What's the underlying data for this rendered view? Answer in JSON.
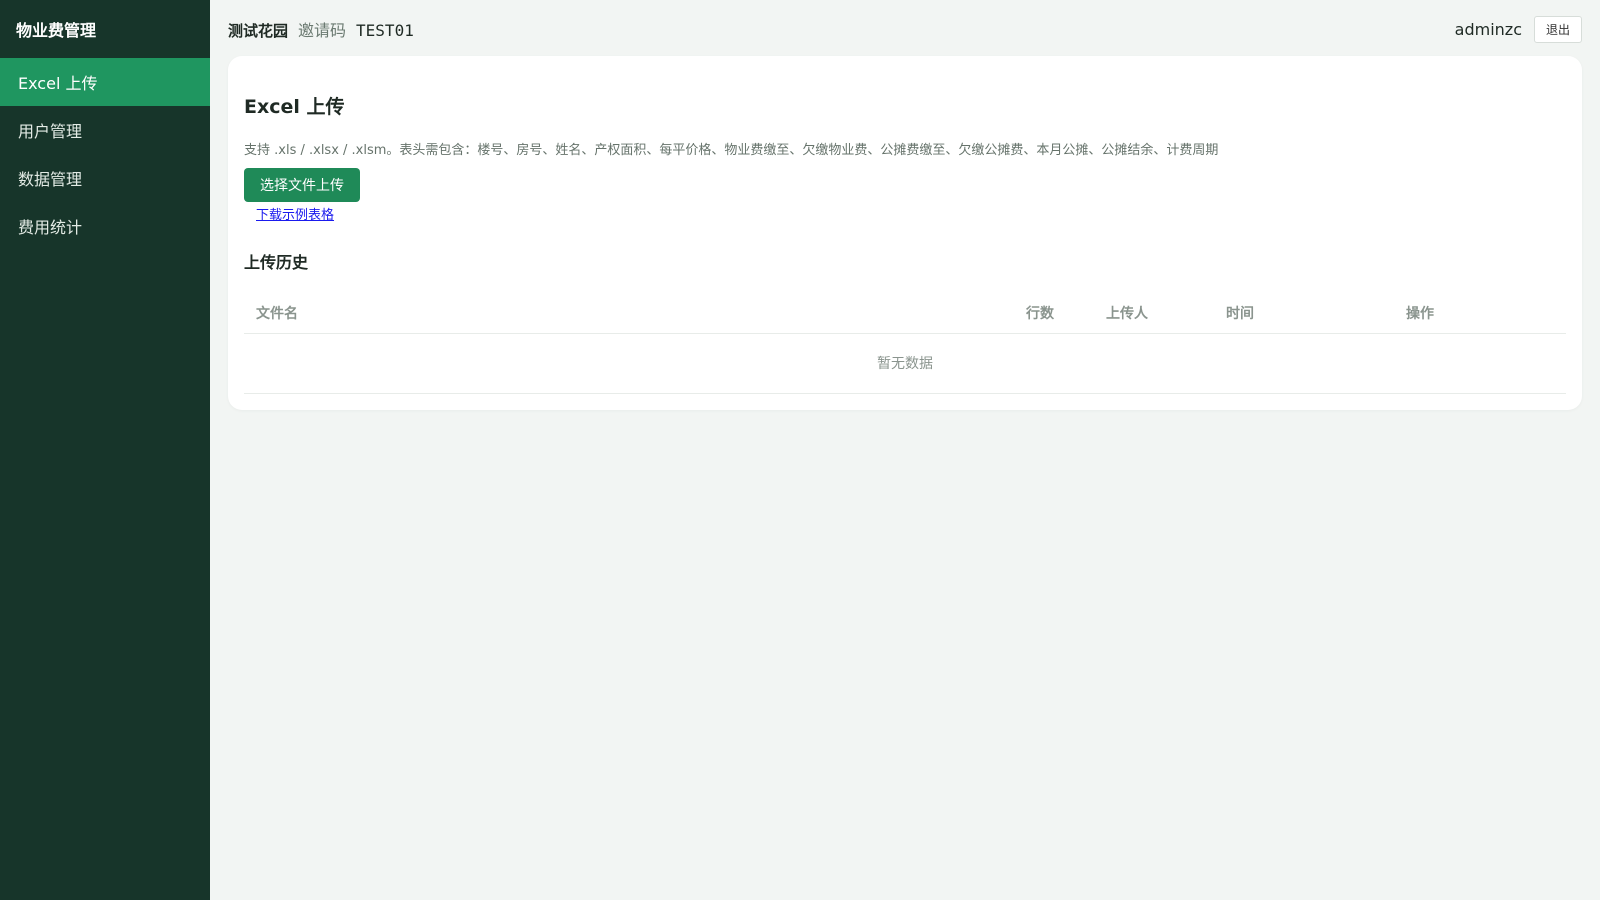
{
  "sidebar": {
    "brand": "物业费管理",
    "items": [
      {
        "label": "Excel 上传",
        "active": true
      },
      {
        "label": "用户管理",
        "active": false
      },
      {
        "label": "数据管理",
        "active": false
      },
      {
        "label": "费用统计",
        "active": false
      }
    ]
  },
  "header": {
    "community": "测试花园",
    "invite_label": "邀请码",
    "invite_code": "TEST01",
    "username": "adminzc",
    "logout_label": "退出"
  },
  "upload": {
    "title": "Excel 上传",
    "hint": "支持 .xls / .xlsx / .xlsm。表头需包含：楼号、房号、姓名、产权面积、每平价格、物业费缴至、欠缴物业费、公摊费缴至、欠缴公摊费、本月公摊、公摊结余、计费周期",
    "upload_button": "选择文件上传",
    "download_link": "下载示例表格"
  },
  "history": {
    "title": "上传历史",
    "columns": [
      "文件名",
      "行数",
      "上传人",
      "时间",
      "操作"
    ],
    "empty_text": "暂无数据"
  },
  "colors": {
    "sidebar_bg": "#17352a",
    "active_item": "#1f9660",
    "primary_button": "#1f8a58",
    "page_bg": "#f2f5f3"
  }
}
